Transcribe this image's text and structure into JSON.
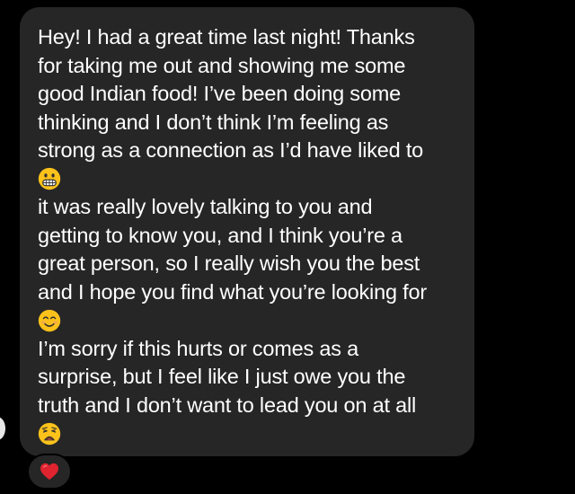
{
  "message": {
    "paragraphs": [
      {
        "lines": [
          "Hey! I had a great time last night! Thanks",
          "for taking me out and showing me some",
          "good Indian food! I’ve been doing some",
          "thinking and I don’t think I’m feeling as",
          "strong as a connection as I’d have liked to"
        ],
        "emoji": "grimacing-face"
      },
      {
        "lines": [
          "it was really lovely talking to you and",
          "getting to know you, and I think you’re a",
          "great person, so I really wish you the best",
          "and I hope you find what you’re looking for"
        ],
        "emoji": "smiling-face-with-smiling-eyes"
      },
      {
        "lines": [
          "I’m sorry if this hurts or comes as a",
          "surprise, but I feel like I just owe you the",
          "truth and I don’t want to lead you on at all"
        ],
        "emoji": "weary-face"
      }
    ]
  },
  "reaction": {
    "icon": "red-heart-icon"
  },
  "colors": {
    "background": "#000000",
    "bubble": "#262626",
    "text": "#ffffff",
    "emoji_yellow": "#fcc21b",
    "heart": "#e0242f"
  }
}
